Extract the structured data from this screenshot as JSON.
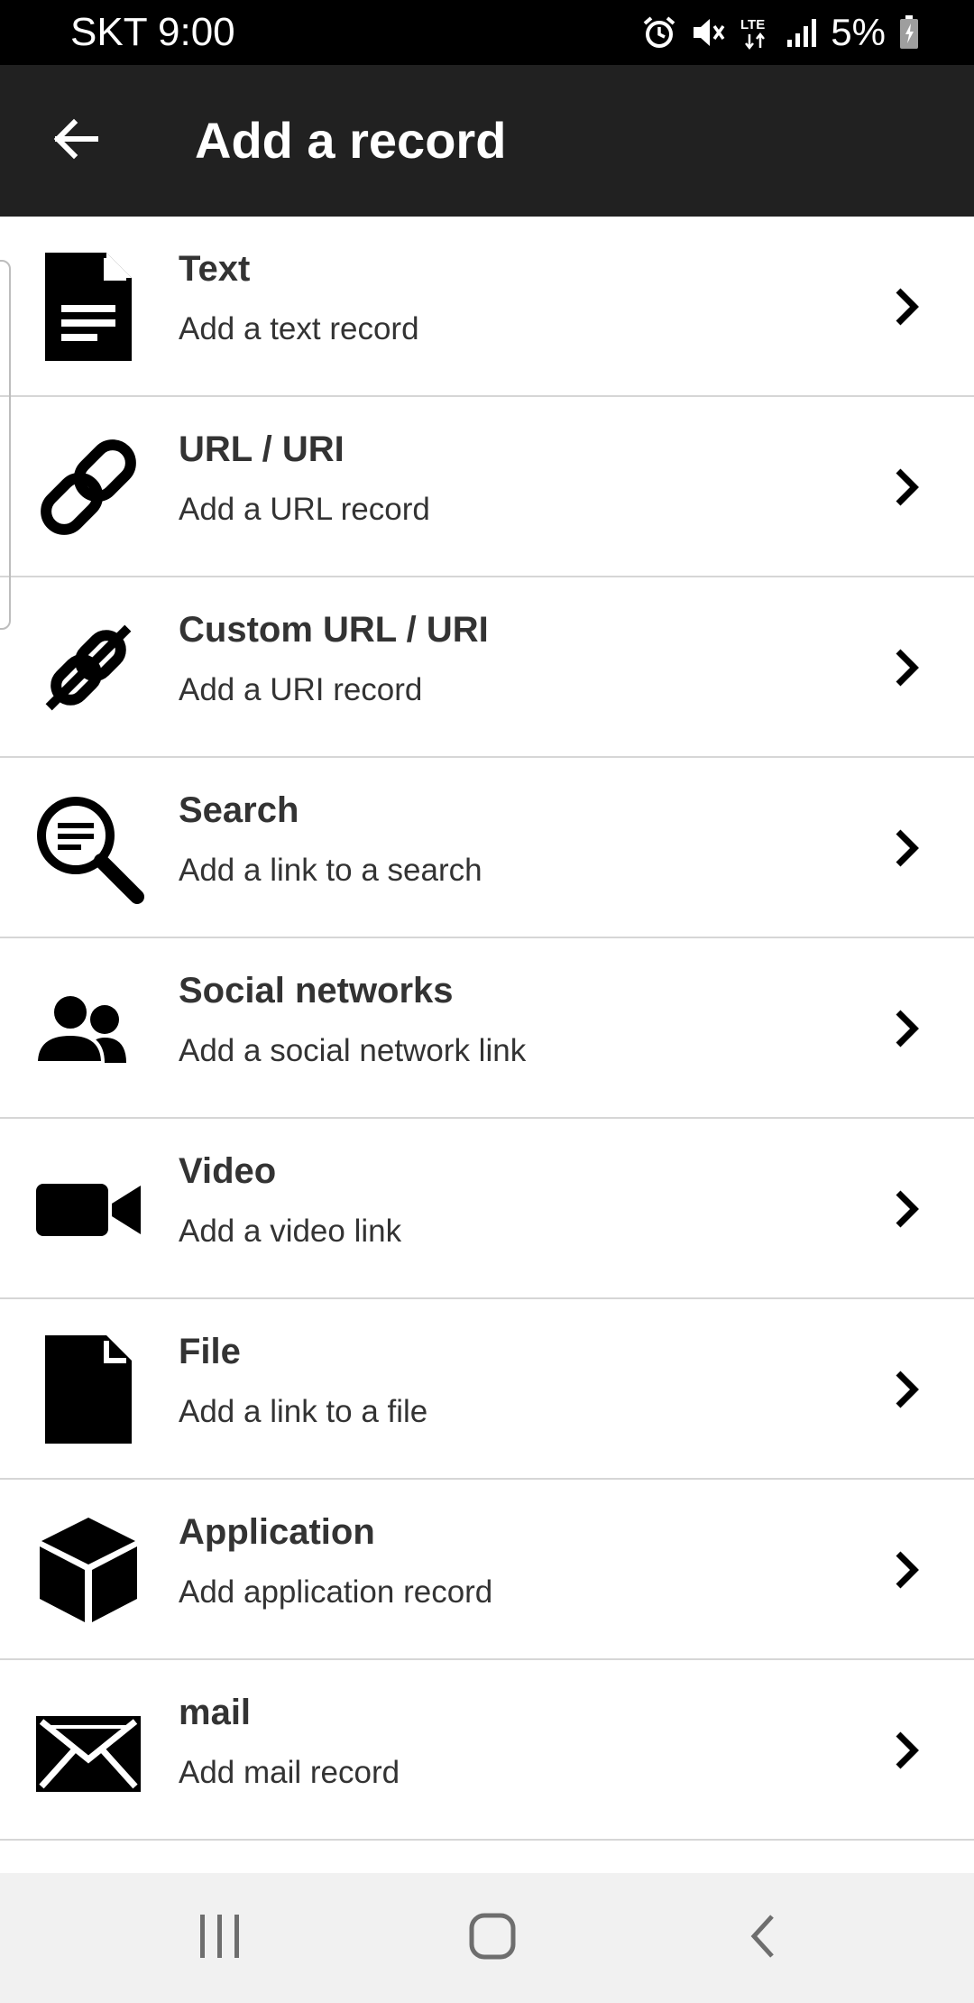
{
  "status_bar": {
    "carrier_time": "SKT 9:00",
    "battery": "5%",
    "network": "LTE",
    "icons": [
      "alarm-icon",
      "mute-icon",
      "lte-icon",
      "signal-icon",
      "battery-icon"
    ]
  },
  "app_bar": {
    "title": "Add a record",
    "back_icon": "arrow-left-icon"
  },
  "records": [
    {
      "title": "Text",
      "subtitle": "Add a text record",
      "icon": "text-document-icon"
    },
    {
      "title": "URL / URI",
      "subtitle": "Add a URL record",
      "icon": "link-icon"
    },
    {
      "title": "Custom URL / URI",
      "subtitle": "Add a URI record",
      "icon": "custom-link-icon"
    },
    {
      "title": "Search",
      "subtitle": "Add a link to a search",
      "icon": "search-icon"
    },
    {
      "title": "Social networks",
      "subtitle": "Add a social network link",
      "icon": "people-icon"
    },
    {
      "title": "Video",
      "subtitle": "Add a video link",
      "icon": "video-camera-icon"
    },
    {
      "title": "File",
      "subtitle": "Add a link to a file",
      "icon": "file-icon"
    },
    {
      "title": "Application",
      "subtitle": "Add application record",
      "icon": "cube-icon"
    },
    {
      "title": "mail",
      "subtitle": "Add mail record",
      "icon": "mail-icon"
    }
  ],
  "nav_bar": {
    "icons": [
      "recents-icon",
      "home-icon",
      "back-icon"
    ]
  },
  "colors": {
    "status_bar_bg": "#000000",
    "app_bar_bg": "#212121",
    "list_bg": "#ffffff",
    "divider": "#d6d6d6",
    "text": "#333333",
    "nav_bar_bg": "#f1f1f1"
  }
}
